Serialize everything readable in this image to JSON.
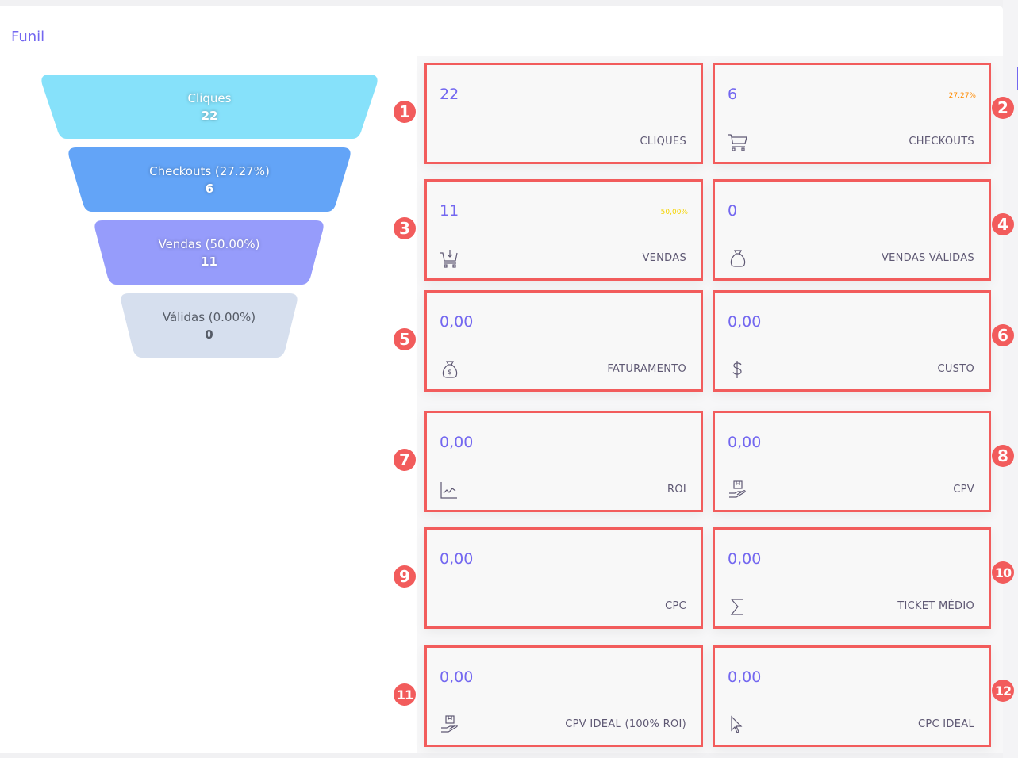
{
  "panel": {
    "title": "Funil"
  },
  "funnel": [
    {
      "label": "Cliques",
      "value": "22",
      "color": "#86e1fa"
    },
    {
      "label": "Checkouts (27.27%)",
      "value": "6",
      "color": "#63a4f7"
    },
    {
      "label": "Vendas (50.00%)",
      "value": "11",
      "color": "#969cfb"
    },
    {
      "label": "Válidas (0.00%)",
      "value": "0",
      "color": "#d6dfee"
    }
  ],
  "cards": [
    {
      "badge": "1",
      "value": "22",
      "label": "CLIQUES",
      "icon": "mouse-pointer-icon",
      "pct": ""
    },
    {
      "badge": "2",
      "value": "6",
      "label": "CHECKOUTS",
      "icon": "shopping-cart-icon",
      "pct": "27,27%",
      "pct_color": "#ff8a00"
    },
    {
      "badge": "3",
      "value": "11",
      "label": "VENDAS",
      "icon": "cart-download-icon",
      "pct": "50,00%",
      "pct_color": "#f5d400"
    },
    {
      "badge": "4",
      "value": "0",
      "label": "VENDAS VÁLIDAS",
      "icon": "sack-icon",
      "pct": ""
    },
    {
      "badge": "5",
      "value": "0,00",
      "label": "FATURAMENTO",
      "icon": "money-bag-icon",
      "pct": ""
    },
    {
      "badge": "6",
      "value": "0,00",
      "label": "CUSTO",
      "icon": "dollar-icon",
      "pct": ""
    },
    {
      "badge": "7",
      "value": "0,00",
      "label": "ROI",
      "icon": "line-chart-icon",
      "pct": ""
    },
    {
      "badge": "8",
      "value": "0,00",
      "label": "CPV",
      "icon": "hand-box-icon",
      "pct": ""
    },
    {
      "badge": "9",
      "value": "0,00",
      "label": "CPC",
      "icon": "mouse-pointer-icon",
      "pct": ""
    },
    {
      "badge": "10",
      "value": "0,00",
      "label": "TICKET MÉDIO",
      "icon": "sigma-icon",
      "pct": ""
    },
    {
      "badge": "11",
      "value": "0,00",
      "label": "CPV IDEAL (100% ROI)",
      "icon": "hand-box-icon",
      "pct": ""
    },
    {
      "badge": "12",
      "value": "0,00",
      "label": "CPC IDEAL",
      "icon": "cursor-arrow-icon",
      "pct": ""
    }
  ]
}
